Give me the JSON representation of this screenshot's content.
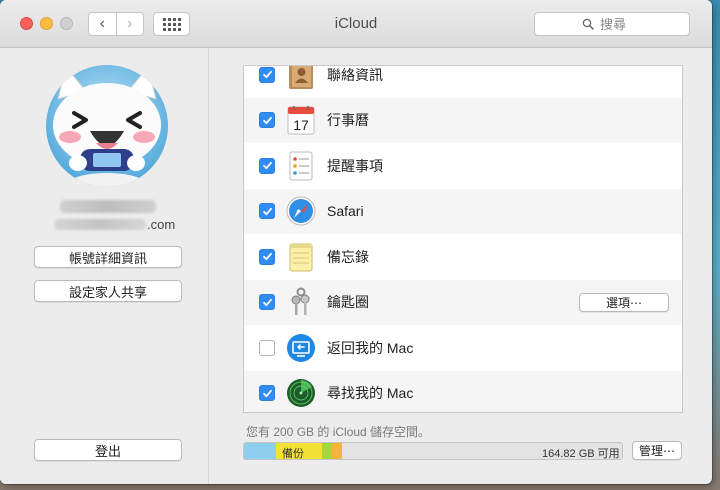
{
  "window": {
    "title": "iCloud",
    "search_placeholder": "搜尋"
  },
  "account": {
    "email_suffix": ".com",
    "details_button": "帳號詳細資訊",
    "family_button": "設定家人共享",
    "sign_out_button": "登出"
  },
  "services": [
    {
      "label": "聯絡資訊",
      "checked": true,
      "icon": "contacts-icon"
    },
    {
      "label": "行事曆",
      "checked": true,
      "icon": "calendar-icon",
      "calendar_day": "17"
    },
    {
      "label": "提醒事項",
      "checked": true,
      "icon": "reminders-icon"
    },
    {
      "label": "Safari",
      "checked": true,
      "icon": "safari-icon"
    },
    {
      "label": "備忘錄",
      "checked": true,
      "icon": "notes-icon"
    },
    {
      "label": "鑰匙圈",
      "checked": true,
      "icon": "keychain-icon",
      "options_button": "選項⋯"
    },
    {
      "label": "返回我的 Mac",
      "checked": false,
      "icon": "back-to-my-mac-icon"
    },
    {
      "label": "尋找我的 Mac",
      "checked": true,
      "icon": "find-my-mac-icon"
    }
  ],
  "storage": {
    "summary": "您有 200 GB 的 iCloud 儲存空間。",
    "backup_label": "備份",
    "free_label": "164.82 GB 可用",
    "manage_button": "管理⋯"
  },
  "colors": {
    "accent": "#2e8cf3",
    "storage_blue": "#8ecff0",
    "storage_yellow": "#f3e235",
    "storage_green": "#a6d83d",
    "storage_orange": "#f4b33b"
  }
}
